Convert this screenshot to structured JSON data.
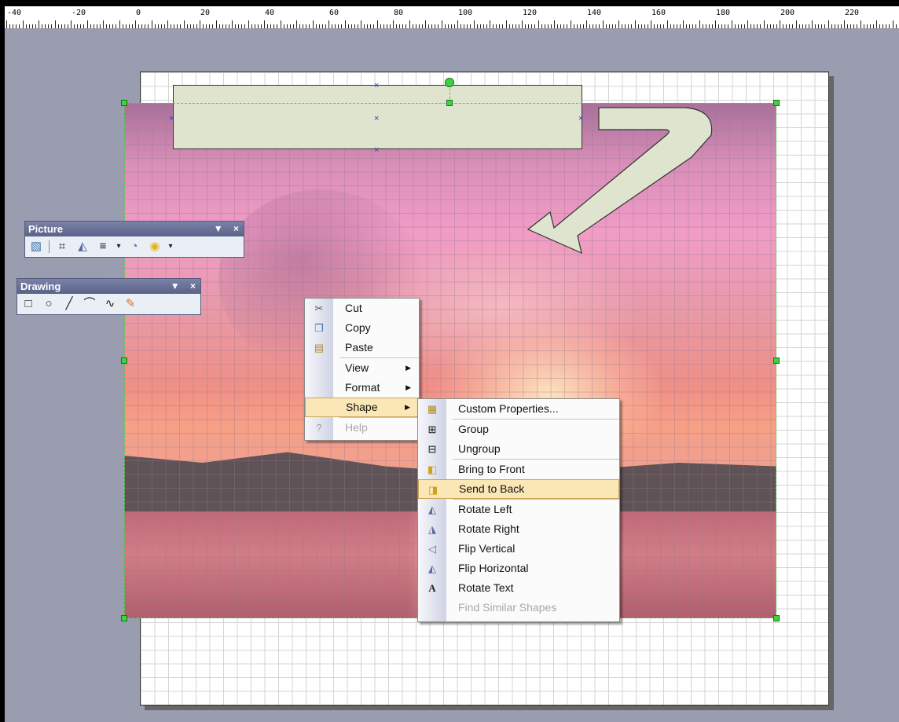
{
  "ruler": {
    "labels": [
      "-40",
      "-20",
      "0",
      "20",
      "40",
      "60",
      "80",
      "100",
      "120",
      "140",
      "160",
      "180",
      "200",
      "220"
    ]
  },
  "toolbars": {
    "picture": {
      "title": "Picture",
      "dropdown_glyph": "▼",
      "close_glyph": "×",
      "icons": [
        "insert-picture-icon",
        "crop-icon",
        "rotate-left-icon",
        "line-style-icon",
        "dropdown-arrow-icon",
        "fill-icon",
        "shape-color-icon",
        "dropdown-arrow-icon"
      ]
    },
    "drawing": {
      "title": "Drawing",
      "dropdown_glyph": "▼",
      "close_glyph": "×",
      "icons": [
        "rectangle-icon",
        "ellipse-icon",
        "line-icon",
        "arc-icon",
        "freeform-icon",
        "pencil-icon"
      ]
    }
  },
  "context_menu": {
    "items": [
      {
        "label": "Cut",
        "icon": "scissors-icon"
      },
      {
        "label": "Copy",
        "icon": "copy-icon"
      },
      {
        "label": "Paste",
        "icon": "paste-icon"
      },
      {
        "label": "View",
        "submenu": true
      },
      {
        "label": "Format",
        "submenu": true
      },
      {
        "label": "Shape",
        "submenu": true,
        "highlighted": true
      },
      {
        "label": "Help",
        "icon": "help-icon",
        "disabled": true
      }
    ]
  },
  "shape_submenu": {
    "items": [
      {
        "label": "Custom Properties...",
        "icon": "custom-properties-icon"
      },
      {
        "label": "Group",
        "icon": "group-icon"
      },
      {
        "label": "Ungroup",
        "icon": "ungroup-icon"
      },
      {
        "label": "Bring to Front",
        "icon": "bring-to-front-icon"
      },
      {
        "label": "Send to Back",
        "icon": "send-to-back-icon",
        "highlighted": true
      },
      {
        "label": "Rotate Left",
        "icon": "rotate-left-icon"
      },
      {
        "label": "Rotate Right",
        "icon": "rotate-right-icon"
      },
      {
        "label": "Flip Vertical",
        "icon": "flip-vertical-icon"
      },
      {
        "label": "Flip Horizontal",
        "icon": "flip-horizontal-icon"
      },
      {
        "label": "Rotate Text",
        "icon": "rotate-text-icon"
      },
      {
        "label": "Find Similar Shapes",
        "disabled": true
      }
    ]
  },
  "colors": {
    "handle": "#3ed23e",
    "menu_highlight": "#fbe7b6",
    "shape_fill": "#dfe4ce",
    "canvas_bg": "#9a9cb0"
  }
}
